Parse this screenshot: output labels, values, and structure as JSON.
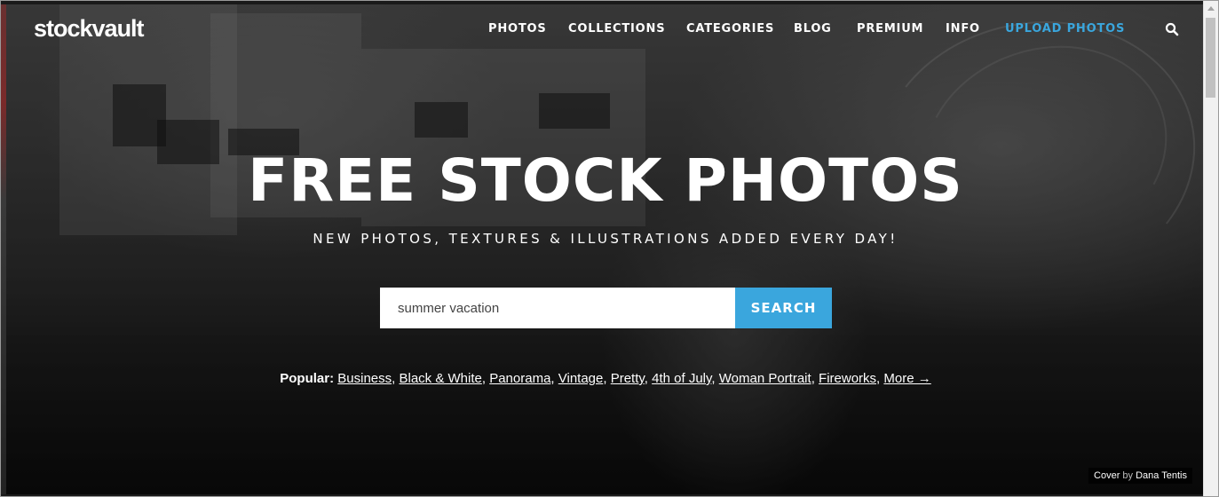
{
  "header": {
    "logo_text": "stockvault",
    "nav": [
      {
        "label": "PHOTOS"
      },
      {
        "label": "COLLECTIONS"
      },
      {
        "label": "CATEGORIES"
      },
      {
        "label": "BLOG"
      },
      {
        "label": "PREMIUM"
      },
      {
        "label": "INFO"
      },
      {
        "label": "UPLOAD PHOTOS"
      }
    ],
    "search_icon": "search-icon"
  },
  "hero": {
    "title": "FREE STOCK PHOTOS",
    "subtitle": "NEW PHOTOS, TEXTURES & ILLUSTRATIONS ADDED EVERY DAY!"
  },
  "search": {
    "value": "summer vacation",
    "button_label": "SEARCH"
  },
  "popular": {
    "label": "Popular:",
    "items": [
      "Business",
      "Black & White",
      "Panorama",
      "Vintage",
      "Pretty",
      "4th of July",
      "Woman Portrait",
      "Fireworks"
    ],
    "more_label": "More →"
  },
  "credit": {
    "prefix": "Cover",
    "by": "by",
    "author": "Dana Tentis"
  },
  "colors": {
    "accent": "#3aa6dd",
    "text": "#ffffff"
  }
}
